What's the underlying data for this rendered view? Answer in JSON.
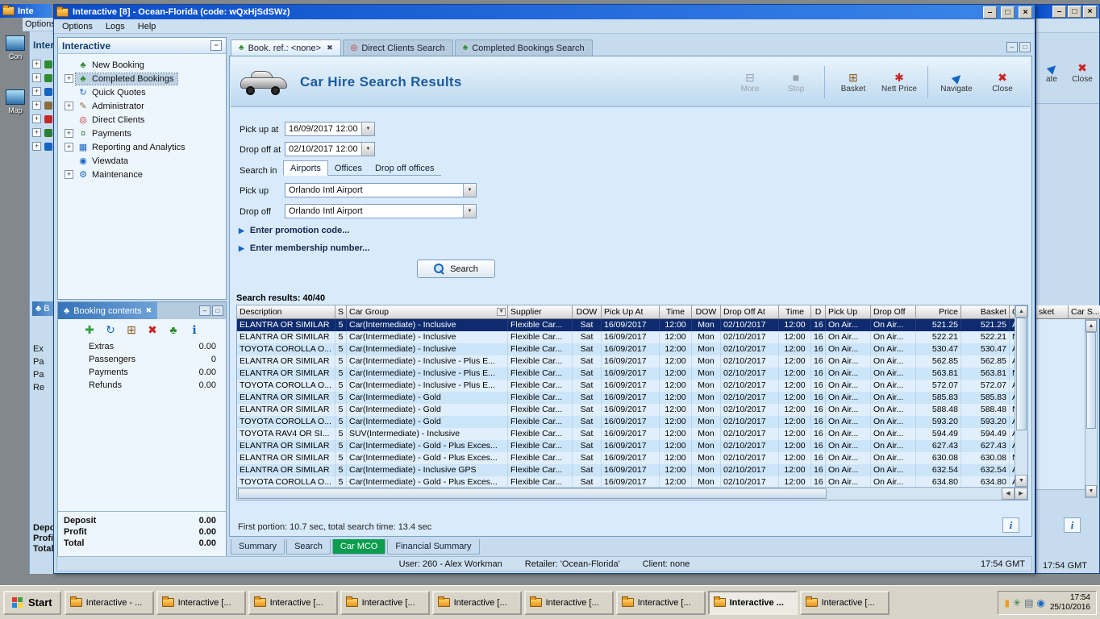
{
  "icons": {
    "minimize": "–",
    "maximize": "□",
    "close": "×",
    "tab_close": "✖",
    "dropdown": "▼",
    "expand": "+",
    "collapse": "−",
    "link_arrow": "▶",
    "filter": "▼",
    "scroll_up": "▲",
    "scroll_down": "▼",
    "scroll_left": "◀",
    "scroll_right": "▶",
    "info": "i",
    "palm": "♣"
  },
  "desktop": {
    "icons": [
      {
        "label": "Con"
      },
      {
        "label": "Map"
      }
    ]
  },
  "background_left": {
    "title_fragment": "Inte",
    "menu_fragment": "Options",
    "panel_header_fragment": "Inter",
    "booking_tab_fragment": "B",
    "tree_dots": [
      "#2e8b2e",
      "#2e8b2e",
      "#1565c0",
      "#8a6d3b",
      "#c62828",
      "#2e7d32",
      "#1565c0"
    ],
    "field_fragments": [
      "Ex",
      "Pa",
      "Pa",
      "Re"
    ],
    "total_fragments": [
      "Depo",
      "Profit",
      "Total"
    ]
  },
  "background_right": {
    "toolbar_fragments": [
      {
        "label": "ate",
        "icon": "navigate-icon",
        "glyph": "▶",
        "color": "#1565c0"
      },
      {
        "label": "Close",
        "icon": "close-icon",
        "glyph": "✖",
        "color": "#cc2222"
      }
    ],
    "column_fragments": [
      {
        "label": "sket"
      },
      {
        "label": "Car S..."
      }
    ],
    "info_label": "i",
    "time": "17:54 GMT"
  },
  "window": {
    "title": "Interactive [8] - Ocean-Florida (code: wQxHjSdSWz)",
    "menu": [
      "Options",
      "Logs",
      "Help"
    ]
  },
  "sidebar": {
    "title": "Interactive",
    "items": [
      {
        "label": "New Booking",
        "icon": "palm-icon",
        "glyph": "♣",
        "color": "#2e8b2e",
        "expandable": false,
        "selected": false
      },
      {
        "label": "Completed Bookings",
        "icon": "palm-icon",
        "glyph": "♣",
        "color": "#2e8b2e",
        "expandable": true,
        "selected": true
      },
      {
        "label": "Quick Quotes",
        "icon": "refresh-icon",
        "glyph": "↻",
        "color": "#1565c0",
        "expandable": false,
        "selected": false
      },
      {
        "label": "Administrator",
        "icon": "pencil-icon",
        "glyph": "✎",
        "color": "#8a6d3b",
        "expandable": true,
        "selected": false
      },
      {
        "label": "Direct Clients",
        "icon": "target-icon",
        "glyph": "◎",
        "color": "#c62828",
        "expandable": false,
        "selected": false
      },
      {
        "label": "Payments",
        "icon": "payments-icon",
        "glyph": "¤",
        "color": "#2e7d32",
        "expandable": true,
        "selected": false
      },
      {
        "label": "Reporting and Analytics",
        "icon": "chart-icon",
        "glyph": "▦",
        "color": "#1565c0",
        "expandable": true,
        "selected": false
      },
      {
        "label": "Viewdata",
        "icon": "viewdata-icon",
        "glyph": "◉",
        "color": "#1565c0",
        "expandable": false,
        "selected": false
      },
      {
        "label": "Maintenance",
        "icon": "gear-icon",
        "glyph": "⚙",
        "color": "#1565c0",
        "expandable": true,
        "selected": false
      }
    ]
  },
  "booking_contents": {
    "title": "Booking contents",
    "toolbar": [
      {
        "icon": "add-icon",
        "glyph": "✚",
        "color": "#2e9e3e"
      },
      {
        "icon": "refresh-icon",
        "glyph": "↻",
        "color": "#1565c0"
      },
      {
        "icon": "basket-icon",
        "glyph": "⊞",
        "color": "#8a5a20"
      },
      {
        "icon": "delete-icon",
        "glyph": "✖",
        "color": "#cc2222"
      },
      {
        "icon": "palm-icon",
        "glyph": "♣",
        "color": "#2e8b2e"
      },
      {
        "icon": "info-icon",
        "glyph": "ℹ",
        "color": "#1565c0"
      }
    ],
    "fields": [
      {
        "label": "Extras",
        "value": "0.00"
      },
      {
        "label": "Passengers",
        "value": "0"
      },
      {
        "label": "Payments",
        "value": "0.00"
      },
      {
        "label": "Refunds",
        "value": "0.00"
      }
    ],
    "totals": [
      {
        "label": "Deposit",
        "value": "0.00"
      },
      {
        "label": "Profit",
        "value": "0.00"
      },
      {
        "label": "Total",
        "value": "0.00"
      }
    ]
  },
  "main": {
    "tabs": [
      {
        "label": "Book. ref.: <none>",
        "active": true,
        "closable": true,
        "glyph": "♣",
        "color": "#2e8b2e"
      },
      {
        "label": "Direct Clients Search",
        "active": false,
        "closable": false,
        "glyph": "◎",
        "color": "#c62828"
      },
      {
        "label": "Completed Bookings Search",
        "active": false,
        "closable": false,
        "glyph": "♣",
        "color": "#2e8b2e"
      }
    ],
    "page_title": "Car Hire Search Results",
    "toolbar": [
      {
        "label": "More",
        "icon": "more-icon",
        "glyph": "⊟",
        "color": "#9aa4ae",
        "enabled": false,
        "group_end": false
      },
      {
        "label": "Stop",
        "icon": "stop-icon",
        "glyph": "■",
        "color": "#9aa4ae",
        "enabled": false,
        "group_end": true
      },
      {
        "label": "Basket",
        "icon": "basket-icon",
        "glyph": "⊞",
        "color": "#8a5a20",
        "enabled": true,
        "group_end": false
      },
      {
        "label": "Nett Price",
        "icon": "nett-price-icon",
        "glyph": "✱",
        "color": "#cc2222",
        "enabled": true,
        "group_end": true
      },
      {
        "label": "Navigate",
        "icon": "navigate-icon",
        "glyph": "▶",
        "color": "#1565c0",
        "enabled": true,
        "group_end": false
      },
      {
        "label": "Close",
        "icon": "close-icon",
        "glyph": "✖",
        "color": "#cc2222",
        "enabled": true,
        "group_end": false
      }
    ],
    "form": {
      "pickup_at_label": "Pick up at",
      "pickup_at_value": "16/09/2017 12:00",
      "dropoff_at_label": "Drop off at",
      "dropoff_at_value": "02/10/2017 12:00",
      "search_in_label": "Search in",
      "search_in_tabs": [
        {
          "label": "Airports",
          "selected": true
        },
        {
          "label": "Offices",
          "selected": false
        },
        {
          "label": "Drop off offices",
          "selected": false
        }
      ],
      "pickup_label": "Pick up",
      "pickup_value": "Orlando Intl Airport",
      "dropoff_label": "Drop off",
      "dropoff_value": "Orlando Intl Airport",
      "promo_link": "Enter promotion code...",
      "membership_link": "Enter membership number...",
      "search_button": "Search"
    },
    "results": {
      "summary": "Search results: 40/40",
      "columns": [
        "Description",
        "S",
        "Car Group",
        "Supplier",
        "DOW",
        "Pick Up At",
        "Time",
        "DOW",
        "Drop Off At",
        "Time",
        "D",
        "Pick Up",
        "Drop Off",
        "Price",
        "Basket",
        "Ca..."
      ],
      "selected_row": 0,
      "rows": [
        [
          "ELANTRA OR SIMILAR",
          "5",
          "Car(Intermediate) - Inclusive",
          "Flexible Car...",
          "Sat",
          "16/09/2017",
          "12:00",
          "Mon",
          "02/10/2017",
          "12:00",
          "16",
          "On Air...",
          "On Air...",
          "521.25",
          "521.25",
          "Ala"
        ],
        [
          "ELANTRA OR SIMILAR",
          "5",
          "Car(Intermediate) - Inclusive",
          "Flexible Car...",
          "Sat",
          "16/09/2017",
          "12:00",
          "Mon",
          "02/10/2017",
          "12:00",
          "16",
          "On Air...",
          "On Air...",
          "522.21",
          "522.21",
          "Na"
        ],
        [
          "TOYOTA COROLLA O...",
          "5",
          "Car(Intermediate) - Inclusive",
          "Flexible Car...",
          "Sat",
          "16/09/2017",
          "12:00",
          "Mon",
          "02/10/2017",
          "12:00",
          "16",
          "On Air...",
          "On Air...",
          "530.47",
          "530.47",
          "Ala"
        ],
        [
          "ELANTRA OR SIMILAR",
          "5",
          "Car(Intermediate) - Inclusive - Plus E...",
          "Flexible Car...",
          "Sat",
          "16/09/2017",
          "12:00",
          "Mon",
          "02/10/2017",
          "12:00",
          "16",
          "On Air...",
          "On Air...",
          "562.85",
          "562.85",
          "Ala"
        ],
        [
          "ELANTRA OR SIMILAR",
          "5",
          "Car(Intermediate) - Inclusive - Plus E...",
          "Flexible Car...",
          "Sat",
          "16/09/2017",
          "12:00",
          "Mon",
          "02/10/2017",
          "12:00",
          "16",
          "On Air...",
          "On Air...",
          "563.81",
          "563.81",
          "Na"
        ],
        [
          "TOYOTA COROLLA O...",
          "5",
          "Car(Intermediate) - Inclusive - Plus E...",
          "Flexible Car...",
          "Sat",
          "16/09/2017",
          "12:00",
          "Mon",
          "02/10/2017",
          "12:00",
          "16",
          "On Air...",
          "On Air...",
          "572.07",
          "572.07",
          "Ala"
        ],
        [
          "ELANTRA OR SIMILAR",
          "5",
          "Car(Intermediate) - Gold",
          "Flexible Car...",
          "Sat",
          "16/09/2017",
          "12:00",
          "Mon",
          "02/10/2017",
          "12:00",
          "16",
          "On Air...",
          "On Air...",
          "585.83",
          "585.83",
          "Ala"
        ],
        [
          "ELANTRA OR SIMILAR",
          "5",
          "Car(Intermediate) - Gold",
          "Flexible Car...",
          "Sat",
          "16/09/2017",
          "12:00",
          "Mon",
          "02/10/2017",
          "12:00",
          "16",
          "On Air...",
          "On Air...",
          "588.48",
          "588.48",
          "Na"
        ],
        [
          "TOYOTA COROLLA O...",
          "5",
          "Car(Intermediate) - Gold",
          "Flexible Car...",
          "Sat",
          "16/09/2017",
          "12:00",
          "Mon",
          "02/10/2017",
          "12:00",
          "16",
          "On Air...",
          "On Air...",
          "593.20",
          "593.20",
          "Ala"
        ],
        [
          "TOYOTA RAV4 OR SI...",
          "5",
          "SUV(Intermediate) - Inclusive",
          "Flexible Car...",
          "Sat",
          "16/09/2017",
          "12:00",
          "Mon",
          "02/10/2017",
          "12:00",
          "16",
          "On Air...",
          "On Air...",
          "594.49",
          "594.49",
          "Ala"
        ],
        [
          "ELANTRA OR SIMILAR",
          "5",
          "Car(Intermediate) - Gold - Plus Exces...",
          "Flexible Car...",
          "Sat",
          "16/09/2017",
          "12:00",
          "Mon",
          "02/10/2017",
          "12:00",
          "16",
          "On Air...",
          "On Air...",
          "627.43",
          "627.43",
          "Ala"
        ],
        [
          "ELANTRA OR SIMILAR",
          "5",
          "Car(Intermediate) - Gold - Plus Exces...",
          "Flexible Car...",
          "Sat",
          "16/09/2017",
          "12:00",
          "Mon",
          "02/10/2017",
          "12:00",
          "16",
          "On Air...",
          "On Air...",
          "630.08",
          "630.08",
          "Na"
        ],
        [
          "ELANTRA OR SIMILAR",
          "5",
          "Car(Intermediate) - Inclusive GPS",
          "Flexible Car...",
          "Sat",
          "16/09/2017",
          "12:00",
          "Mon",
          "02/10/2017",
          "12:00",
          "16",
          "On Air...",
          "On Air...",
          "632.54",
          "632.54",
          "Ala"
        ],
        [
          "TOYOTA COROLLA O...",
          "5",
          "Car(Intermediate) - Gold - Plus Exces...",
          "Flexible Car...",
          "Sat",
          "16/09/2017",
          "12:00",
          "Mon",
          "02/10/2017",
          "12:00",
          "16",
          "On Air...",
          "On Air...",
          "634.80",
          "634.80",
          "Ala"
        ]
      ]
    },
    "status_line": "First portion: 10.7 sec, total search time: 13.4 sec",
    "bottom_tabs": [
      {
        "label": "Summary",
        "active": false
      },
      {
        "label": "Search",
        "active": false
      },
      {
        "label": "Car MCO",
        "active": true
      },
      {
        "label": "Financial Summary",
        "active": false
      }
    ]
  },
  "statusbar": {
    "user": "User: 260 - Alex Workman",
    "retailer": "Retailer: 'Ocean-Florida'",
    "client": "Client: none",
    "time": "17:54 GMT"
  },
  "taskbar": {
    "start_label": "Start",
    "buttons": [
      {
        "label": "Interactive - ...",
        "active": false
      },
      {
        "label": "Interactive [...",
        "active": false
      },
      {
        "label": "Interactive [...",
        "active": false
      },
      {
        "label": "Interactive [...",
        "active": false
      },
      {
        "label": "Interactive [...",
        "active": false
      },
      {
        "label": "Interactive [...",
        "active": false
      },
      {
        "label": "Interactive [...",
        "active": false
      },
      {
        "label": "Interactive ...",
        "active": true
      },
      {
        "label": "Interactive [...",
        "active": false
      }
    ],
    "tray_icons": [
      {
        "icon": "update-tray-icon",
        "glyph": "▮",
        "color": "#e8a020"
      },
      {
        "icon": "network-tray-icon",
        "glyph": "✳",
        "color": "#2e7d32"
      },
      {
        "icon": "printer-tray-icon",
        "glyph": "▤",
        "color": "#5a6a78"
      },
      {
        "icon": "volume-tray-icon",
        "glyph": "◉",
        "color": "#1565c0"
      }
    ],
    "clock_time": "17:54",
    "clock_date": "25/10/2016"
  }
}
